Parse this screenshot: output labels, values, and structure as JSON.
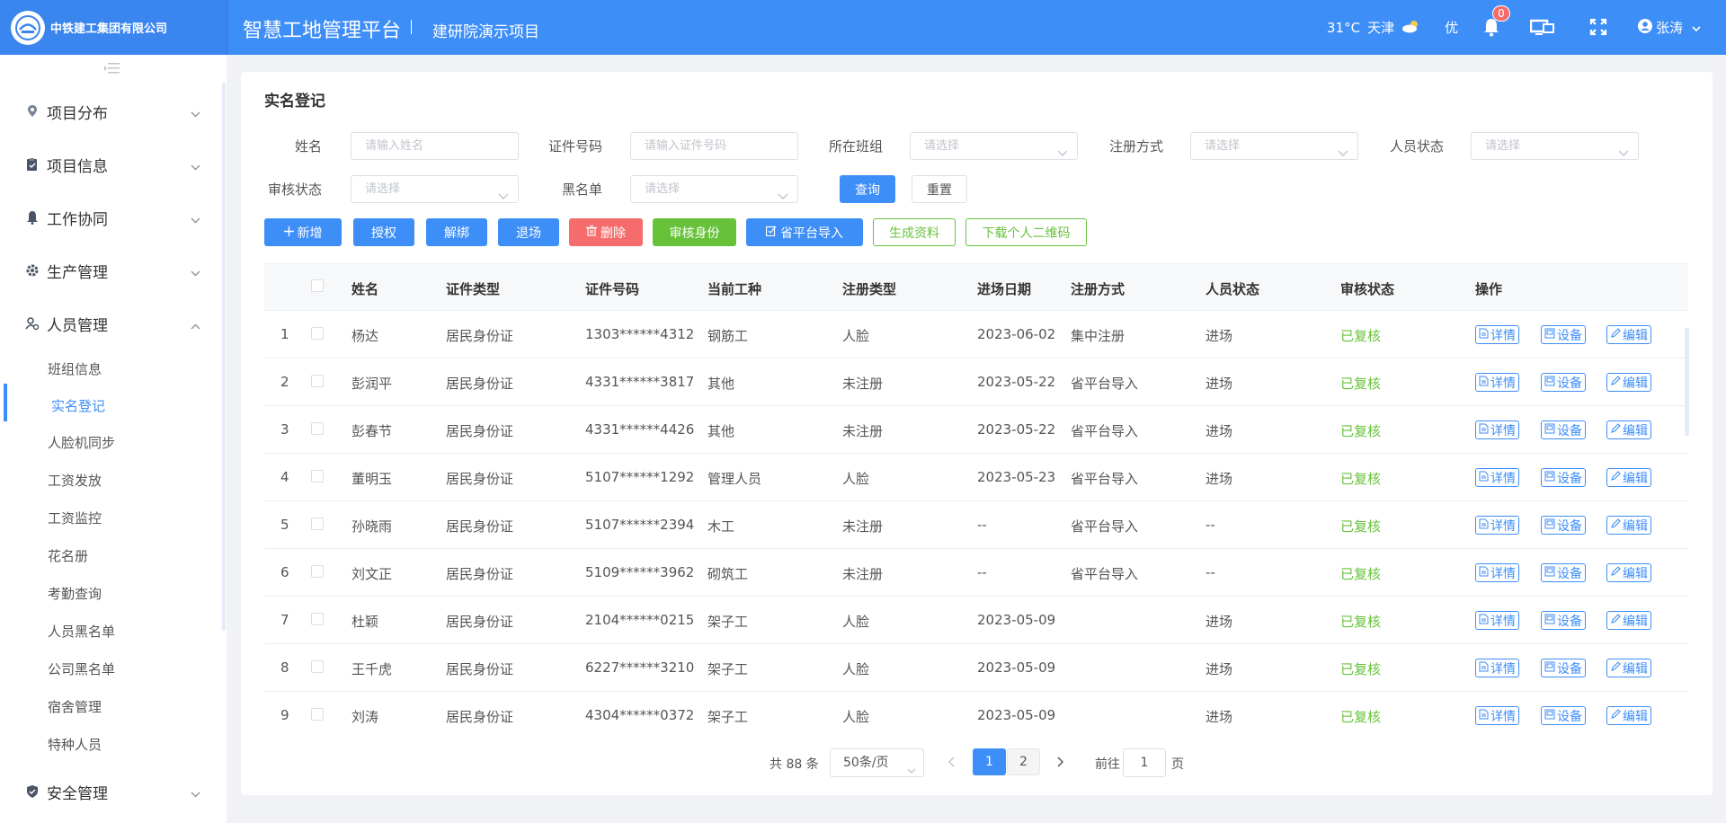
{
  "header": {
    "company": "中铁建工集团有限公司",
    "platform_title": "智慧工地管理平台",
    "project_name": "建研院演示项目",
    "weather": {
      "temp": "31°C",
      "city": "天津",
      "aqi": "优"
    },
    "notification_count": "0",
    "user_name": "张涛"
  },
  "sidebar": {
    "groups": [
      {
        "label": "项目分布",
        "icon": "map-pin-icon"
      },
      {
        "label": "项目信息",
        "icon": "clipboard-icon"
      },
      {
        "label": "工作协同",
        "icon": "bell-icon"
      },
      {
        "label": "生产管理",
        "icon": "gear-icon"
      },
      {
        "label": "人员管理",
        "icon": "user-gear-icon"
      }
    ],
    "sub_items": [
      "班组信息",
      "实名登记",
      "人脸机同步",
      "工资发放",
      "工资监控",
      "花名册",
      "考勤查询",
      "人员黑名单",
      "公司黑名单",
      "宿舍管理",
      "特种人员"
    ],
    "active_sub": "实名登记",
    "last_group": {
      "label": "安全管理",
      "icon": "shield-icon"
    }
  },
  "page": {
    "title": "实名登记",
    "filters": {
      "name_label": "姓名",
      "name_placeholder": "请输入姓名",
      "id_label": "证件号码",
      "id_placeholder": "请输入证件号码",
      "team_label": "所在班组",
      "team_placeholder": "请选择",
      "reg_label": "注册方式",
      "reg_placeholder": "请选择",
      "status_label": "人员状态",
      "status_placeholder": "请选择",
      "audit_label": "审核状态",
      "audit_placeholder": "请选择",
      "blacklist_label": "黑名单",
      "blacklist_placeholder": "请选择",
      "query": "查询",
      "reset": "重置"
    },
    "toolbar": {
      "add": "新增",
      "authorize": "授权",
      "unbind": "解绑",
      "exit": "退场",
      "delete": "删除",
      "audit": "审核身份",
      "import": "省平台导入",
      "generate": "生成资料",
      "download_qr": "下载个人二维码"
    },
    "columns": [
      "姓名",
      "证件类型",
      "证件号码",
      "当前工种",
      "注册类型",
      "进场日期",
      "注册方式",
      "人员状态",
      "审核状态",
      "操作"
    ],
    "actions": {
      "detail": "详情",
      "device": "设备",
      "edit": "编辑"
    },
    "rows": [
      {
        "idx": "1",
        "name": "杨达",
        "id_type": "居民身份证",
        "id_no": "1303******4312",
        "job": "钢筋工",
        "reg_type": "人脸",
        "date": "2023-06-02",
        "reg_method": "集中注册",
        "status": "进场",
        "audit": "已复核"
      },
      {
        "idx": "2",
        "name": "彭润平",
        "id_type": "居民身份证",
        "id_no": "4331******3817",
        "job": "其他",
        "reg_type": "未注册",
        "date": "2023-05-22",
        "reg_method": "省平台导入",
        "status": "进场",
        "audit": "已复核"
      },
      {
        "idx": "3",
        "name": "彭春节",
        "id_type": "居民身份证",
        "id_no": "4331******4426",
        "job": "其他",
        "reg_type": "未注册",
        "date": "2023-05-22",
        "reg_method": "省平台导入",
        "status": "进场",
        "audit": "已复核"
      },
      {
        "idx": "4",
        "name": "董明玉",
        "id_type": "居民身份证",
        "id_no": "5107******1292",
        "job": "管理人员",
        "reg_type": "人脸",
        "date": "2023-05-23",
        "reg_method": "省平台导入",
        "status": "进场",
        "audit": "已复核"
      },
      {
        "idx": "5",
        "name": "孙晓雨",
        "id_type": "居民身份证",
        "id_no": "5107******2394",
        "job": "木工",
        "reg_type": "未注册",
        "date": "--",
        "reg_method": "省平台导入",
        "status": "--",
        "audit": "已复核"
      },
      {
        "idx": "6",
        "name": "刘文正",
        "id_type": "居民身份证",
        "id_no": "5109******3962",
        "job": "砌筑工",
        "reg_type": "未注册",
        "date": "--",
        "reg_method": "省平台导入",
        "status": "--",
        "audit": "已复核"
      },
      {
        "idx": "7",
        "name": "杜颖",
        "id_type": "居民身份证",
        "id_no": "2104******0215",
        "job": "架子工",
        "reg_type": "人脸",
        "date": "2023-05-09",
        "reg_method": "",
        "status": "进场",
        "audit": "已复核"
      },
      {
        "idx": "8",
        "name": "王千虎",
        "id_type": "居民身份证",
        "id_no": "6227******3210",
        "job": "架子工",
        "reg_type": "人脸",
        "date": "2023-05-09",
        "reg_method": "",
        "status": "进场",
        "audit": "已复核"
      },
      {
        "idx": "9",
        "name": "刘涛",
        "id_type": "居民身份证",
        "id_no": "4304******0372",
        "job": "架子工",
        "reg_type": "人脸",
        "date": "2023-05-09",
        "reg_method": "",
        "status": "进场",
        "audit": "已复核"
      }
    ],
    "pagination": {
      "total": "共 88 条",
      "page_size": "50条/页",
      "pages": [
        "1",
        "2"
      ],
      "current": "1",
      "goto_prefix": "前往",
      "goto_value": "1",
      "goto_suffix": "页"
    }
  },
  "colors": {
    "primary": "#3e8ef7",
    "success": "#67c23a",
    "danger": "#f56c6c"
  }
}
